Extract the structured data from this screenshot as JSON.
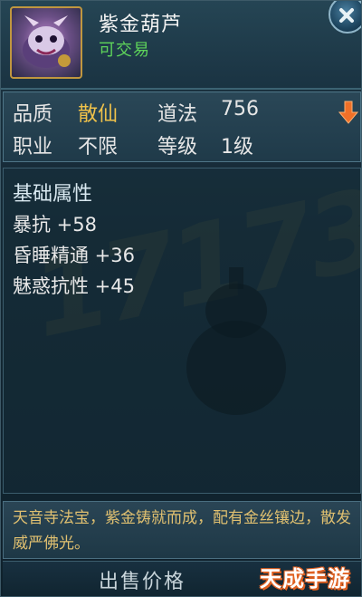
{
  "item": {
    "name": "紫金葫芦",
    "trade_status": "可交易"
  },
  "stats": {
    "quality_label": "品质",
    "quality_value": "散仙",
    "dao_label": "道法",
    "dao_value": "756",
    "job_label": "职业",
    "job_value": "不限",
    "level_label": "等级",
    "level_value": "1级"
  },
  "attributes": {
    "title": "基础属性",
    "lines": [
      "暴抗 +58",
      "昏睡精通 +36",
      "魅惑抗性 +45"
    ]
  },
  "description": "天音寺法宝，紫金铸就而成，配有金丝镶边，散发威严佛光。",
  "footer": {
    "sell_price_label": "出售价格"
  },
  "watermark": {
    "site": "天成手游网",
    "background_mark": "17173"
  },
  "colors": {
    "quality_gold": "#f0c24a",
    "tradeable_green": "#5ed45a",
    "description_gold": "#e0c070",
    "arrow_orange": "#f07028"
  },
  "icons": [
    "item-portrait-icon",
    "close-icon",
    "compare-arrow-icon"
  ]
}
